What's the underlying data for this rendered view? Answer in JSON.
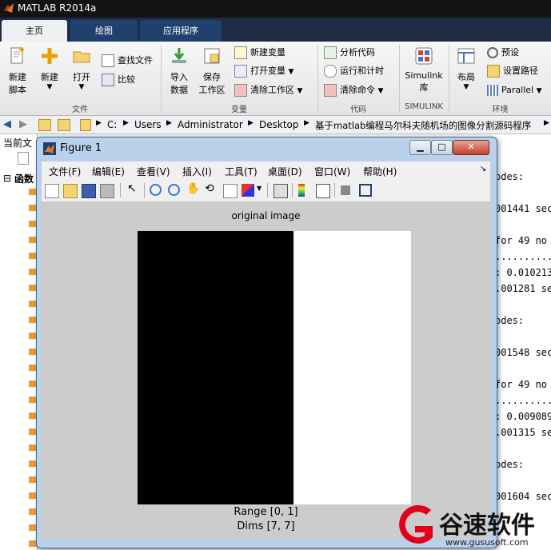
{
  "app": {
    "title": "MATLAB R2014a"
  },
  "tabs": [
    {
      "label": "主页"
    },
    {
      "label": "绘图"
    },
    {
      "label": "应用程序"
    }
  ],
  "ribbon": {
    "file": {
      "new_script": "新建\n脚本",
      "new_script_1": "新建",
      "new_script_2": "脚本",
      "new": "新建",
      "open": "打开",
      "find_files": "查找文件",
      "compare": "比较",
      "group": "文件"
    },
    "variable": {
      "import_1": "导入",
      "import_2": "数据",
      "save_1": "保存",
      "save_2": "工作区",
      "new_variable": "新建变量",
      "open_variable": "打开变量",
      "clear_workspace": "清除工作区",
      "group": "变量"
    },
    "code": {
      "analyze": "分析代码",
      "run_time": "运行和计时",
      "clear_commands": "清除命令",
      "group": "代码"
    },
    "simulink": {
      "lib_1": "Simulink",
      "lib_2": "库",
      "group": "SIMULINK"
    },
    "environment": {
      "layout": "布局",
      "preferences": "预设",
      "set_path": "设置路径",
      "parallel": "Parallel",
      "group": "环境"
    }
  },
  "address": {
    "crumbs": [
      "C:",
      "Users",
      "Administrator",
      "Desktop",
      "基于matlab编程马尔科夫随机场的图像分割源码程序"
    ]
  },
  "left_panel": {
    "current_folder": "当前文",
    "functions": "函数"
  },
  "command_window": {
    "lines": [
      "odes:",
      "001441 sec",
      "for 49 no",
      "..........",
      ": 0.010213",
      ".001281 se",
      "odes:",
      "001548 sec",
      "for 49 no",
      "..........",
      ": 0.009089",
      ".001315 se",
      "odes:",
      "001604 sec"
    ]
  },
  "figure": {
    "title": "Figure 1",
    "menu": [
      "文件(F)",
      "编辑(E)",
      "查看(V)",
      "插入(I)",
      "工具(T)",
      "桌面(D)",
      "窗口(W)",
      "帮助(H)"
    ],
    "image_title": "original image",
    "range": "Range [0, 1]",
    "dims": "Dims [7, 7]"
  },
  "watermark": {
    "brand": "谷速软件",
    "url": "www.gususoft.com"
  },
  "colors": {
    "matlab_tab_bg": "#20406e",
    "figure_frame": "#b9d1ea",
    "watermark_red": "#e0001a"
  }
}
